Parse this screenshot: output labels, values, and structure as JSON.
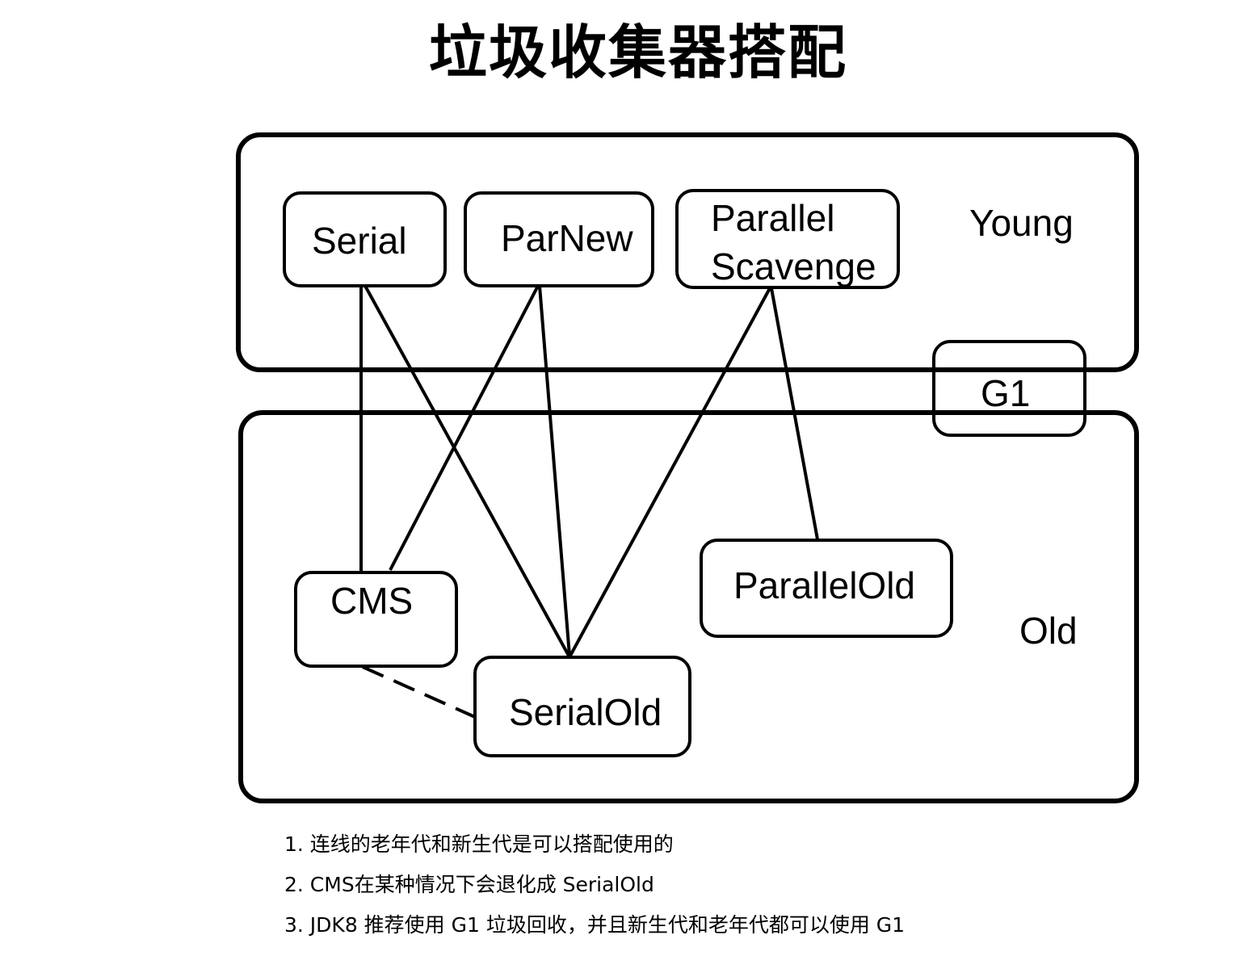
{
  "title": "垃圾收集器搭配",
  "regions": {
    "young": "Young",
    "old": "Old"
  },
  "collectors": {
    "serial": "Serial",
    "parnew": "ParNew",
    "parallel_scavenge_line1": "Parallel",
    "parallel_scavenge_line2": "Scavenge",
    "g1": "G1",
    "cms": "CMS",
    "serial_old": "SerialOld",
    "parallel_old": "ParallelOld"
  },
  "connections": [
    {
      "from": "Serial",
      "to": "CMS",
      "style": "solid"
    },
    {
      "from": "Serial",
      "to": "SerialOld",
      "style": "solid"
    },
    {
      "from": "ParNew",
      "to": "CMS",
      "style": "solid"
    },
    {
      "from": "ParNew",
      "to": "SerialOld",
      "style": "solid"
    },
    {
      "from": "Parallel Scavenge",
      "to": "SerialOld",
      "style": "solid"
    },
    {
      "from": "Parallel Scavenge",
      "to": "ParallelOld",
      "style": "solid"
    },
    {
      "from": "CMS",
      "to": "SerialOld",
      "style": "dashed"
    }
  ],
  "notes": [
    "1. 连线的老年代和新生代是可以搭配使用的",
    "2. CMS在某种情况下会退化成 SerialOld",
    "3. JDK8 推荐使用 G1 垃圾回收，并且新生代和老年代都可以使用 G1"
  ]
}
